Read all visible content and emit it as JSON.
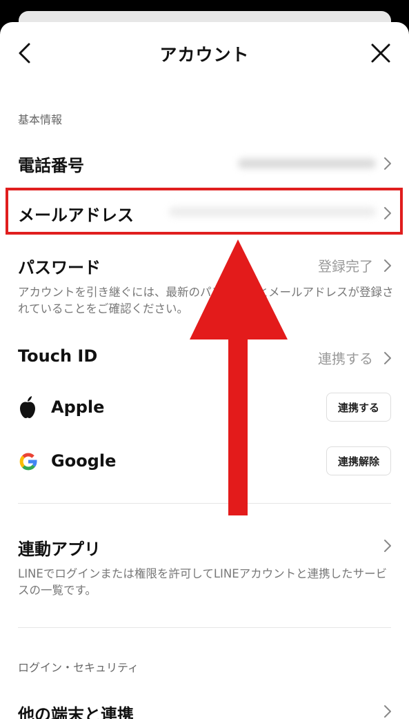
{
  "header": {
    "title": "アカウント"
  },
  "basic_info": {
    "section_label": "基本情報",
    "phone": {
      "label": "電話番号"
    },
    "email": {
      "label": "メールアドレス"
    },
    "password": {
      "label": "パスワード",
      "value": "登録完了",
      "note": "アカウントを引き継ぐには、最新のパスワードとメールアドレスが登録されていることをご確認ください。"
    },
    "touch_id": {
      "label": "Touch ID",
      "value": "連携する"
    },
    "apple": {
      "label": "Apple",
      "button": "連携する"
    },
    "google": {
      "label": "Google",
      "button": "連携解除"
    }
  },
  "linked_apps": {
    "label": "連動アプリ",
    "note": "LINEでログインまたは権限を許可してLINEアカウントと連携したサービスの一覧です。"
  },
  "security": {
    "section_label": "ログイン・セキュリティ",
    "partial_row_label": "他の端末と連携"
  },
  "colors": {
    "highlight": "#e01e1e",
    "arrow": "#e31b1b",
    "value_gray": "#9a9a9a"
  }
}
